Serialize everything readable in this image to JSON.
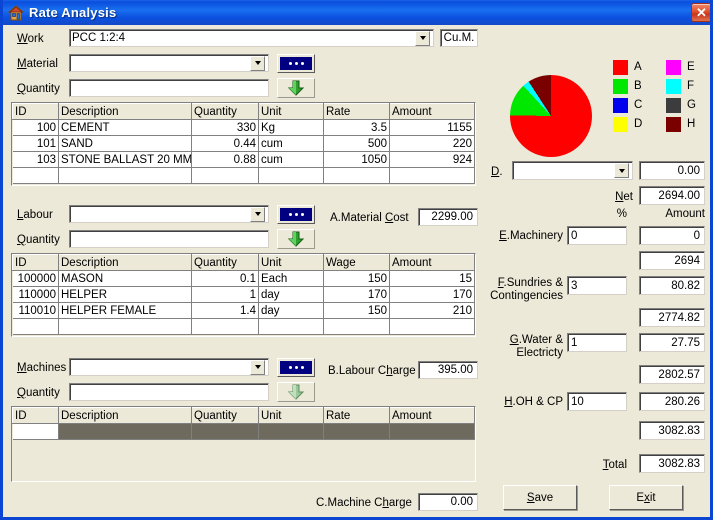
{
  "window": {
    "title": "Rate Analysis",
    "icon": "house-icon",
    "close_label": "✕",
    "accent": "#0a46d2",
    "face": "#ece9d8"
  },
  "work": {
    "label": "Work",
    "label_accel": "W",
    "value": "PCC 1:2:4",
    "unit": "Cu.M."
  },
  "material_section": {
    "material_label": "Material",
    "material_accel": "M",
    "material_value": "",
    "quantity_label": "Quantity",
    "quantity_accel": "Q",
    "quantity_value": "",
    "browse_icon": "ellipsis-icon",
    "add_icon": "down-arrow-icon",
    "cost_label": "A.Material Cost",
    "cost_accel": "C",
    "cost_value": "2299.00",
    "columns": [
      "ID",
      "Description",
      "Quantity",
      "Unit",
      "Rate",
      "Amount"
    ],
    "rows": [
      {
        "id": "100",
        "description": "CEMENT",
        "quantity": "330",
        "unit": "Kg",
        "rate": "3.5",
        "amount": "1155"
      },
      {
        "id": "101",
        "description": "SAND",
        "quantity": "0.44",
        "unit": "cum",
        "rate": "500",
        "amount": "220"
      },
      {
        "id": "103",
        "description": "STONE BALLAST 20 MM",
        "quantity": "0.88",
        "unit": "cum",
        "rate": "1050",
        "amount": "924"
      },
      {
        "id": "",
        "description": "",
        "quantity": "",
        "unit": "",
        "rate": "",
        "amount": ""
      }
    ]
  },
  "labour_section": {
    "labour_label": "Labour",
    "labour_accel": "L",
    "labour_value": "",
    "quantity_label": "Quantity",
    "quantity_accel": "Q",
    "quantity_value": "",
    "browse_icon": "ellipsis-icon",
    "add_icon": "down-arrow-icon",
    "charge_label": "B.Labour Charge",
    "charge_accel": "h",
    "charge_value": "395.00",
    "columns": [
      "ID",
      "Description",
      "Quantity",
      "Unit",
      "Wage",
      "Amount"
    ],
    "rows": [
      {
        "id": "100000",
        "description": "MASON",
        "quantity": "0.1",
        "unit": "Each",
        "rate": "150",
        "amount": "15"
      },
      {
        "id": "110000",
        "description": "HELPER",
        "quantity": "1",
        "unit": "day",
        "rate": "170",
        "amount": "170"
      },
      {
        "id": "110010",
        "description": "HELPER FEMALE",
        "quantity": "1.4",
        "unit": "day",
        "rate": "150",
        "amount": "210"
      },
      {
        "id": "",
        "description": "",
        "quantity": "",
        "unit": "",
        "rate": "",
        "amount": ""
      }
    ]
  },
  "machine_section": {
    "machines_label": "Machines",
    "machines_accel": "M",
    "machines_value": "",
    "quantity_label": "Quantity",
    "quantity_accel": "Q",
    "quantity_value": "",
    "browse_icon": "ellipsis-icon",
    "add_icon": "down-arrow-icon",
    "charge_label": "C.Machine Charge",
    "charge_accel": "h",
    "charge_value": "0.00",
    "columns": [
      "ID",
      "Description",
      "Quantity",
      "Unit",
      "Rate",
      "Amount"
    ],
    "rows": [
      {
        "id": "",
        "description": "",
        "quantity": "",
        "unit": "",
        "rate": "",
        "amount": "",
        "selected": true
      }
    ]
  },
  "summary": {
    "d_label": "D.",
    "d_accel": "D",
    "d_value": "",
    "d_amount": "0.00",
    "net_label": "Net",
    "net_accel": "N",
    "net_value": "2694.00",
    "pct_header": "%",
    "amount_header": "Amount",
    "rows": [
      {
        "label": "E.Machinery",
        "accel": "E",
        "pct": "0",
        "amount": "0",
        "running": "2694"
      },
      {
        "label": "F.Sundries & Contingencies",
        "accel": "F",
        "pct": "3",
        "amount": "80.82",
        "running": "2774.82"
      },
      {
        "label": "G.Water & Electricty",
        "accel": "G",
        "pct": "1",
        "amount": "27.75",
        "running": "2802.57"
      },
      {
        "label": "H.OH & CP",
        "accel": "H",
        "pct": "10",
        "amount": "280.26",
        "running": "3082.83"
      }
    ],
    "total_label": "Total",
    "total_accel": "T",
    "total_value": "3082.83",
    "save_label": "Save",
    "save_accel": "S",
    "exit_label": "Exit",
    "exit_accel": "x"
  },
  "chart_data": {
    "type": "pie",
    "title": "",
    "legend_position": "right",
    "categories": [
      "A",
      "B",
      "C",
      "D",
      "E",
      "F",
      "G",
      "H"
    ],
    "labels": [
      "A",
      "B",
      "C",
      "D",
      "E",
      "F",
      "G",
      "H"
    ],
    "colors": [
      "#ff0000",
      "#00e800",
      "#0000ee",
      "#ffff00",
      "#ff00ff",
      "#00ffff",
      "#3c3c3c",
      "#7a0000"
    ],
    "values": [
      74.6,
      12.8,
      0,
      0,
      0,
      2.6,
      0,
      9.1
    ],
    "series": [
      {
        "name": "A",
        "value": 74.6,
        "color": "#ff0000"
      },
      {
        "name": "B",
        "value": 12.8,
        "color": "#00e800"
      },
      {
        "name": "C",
        "value": 0,
        "color": "#0000ee"
      },
      {
        "name": "D",
        "value": 0,
        "color": "#ffff00"
      },
      {
        "name": "E",
        "value": 0,
        "color": "#ff00ff"
      },
      {
        "name": "F",
        "value": 2.6,
        "color": "#00ffff"
      },
      {
        "name": "G",
        "value": 0,
        "color": "#3c3c3c"
      },
      {
        "name": "H",
        "value": 9.1,
        "color": "#7a0000"
      }
    ]
  }
}
